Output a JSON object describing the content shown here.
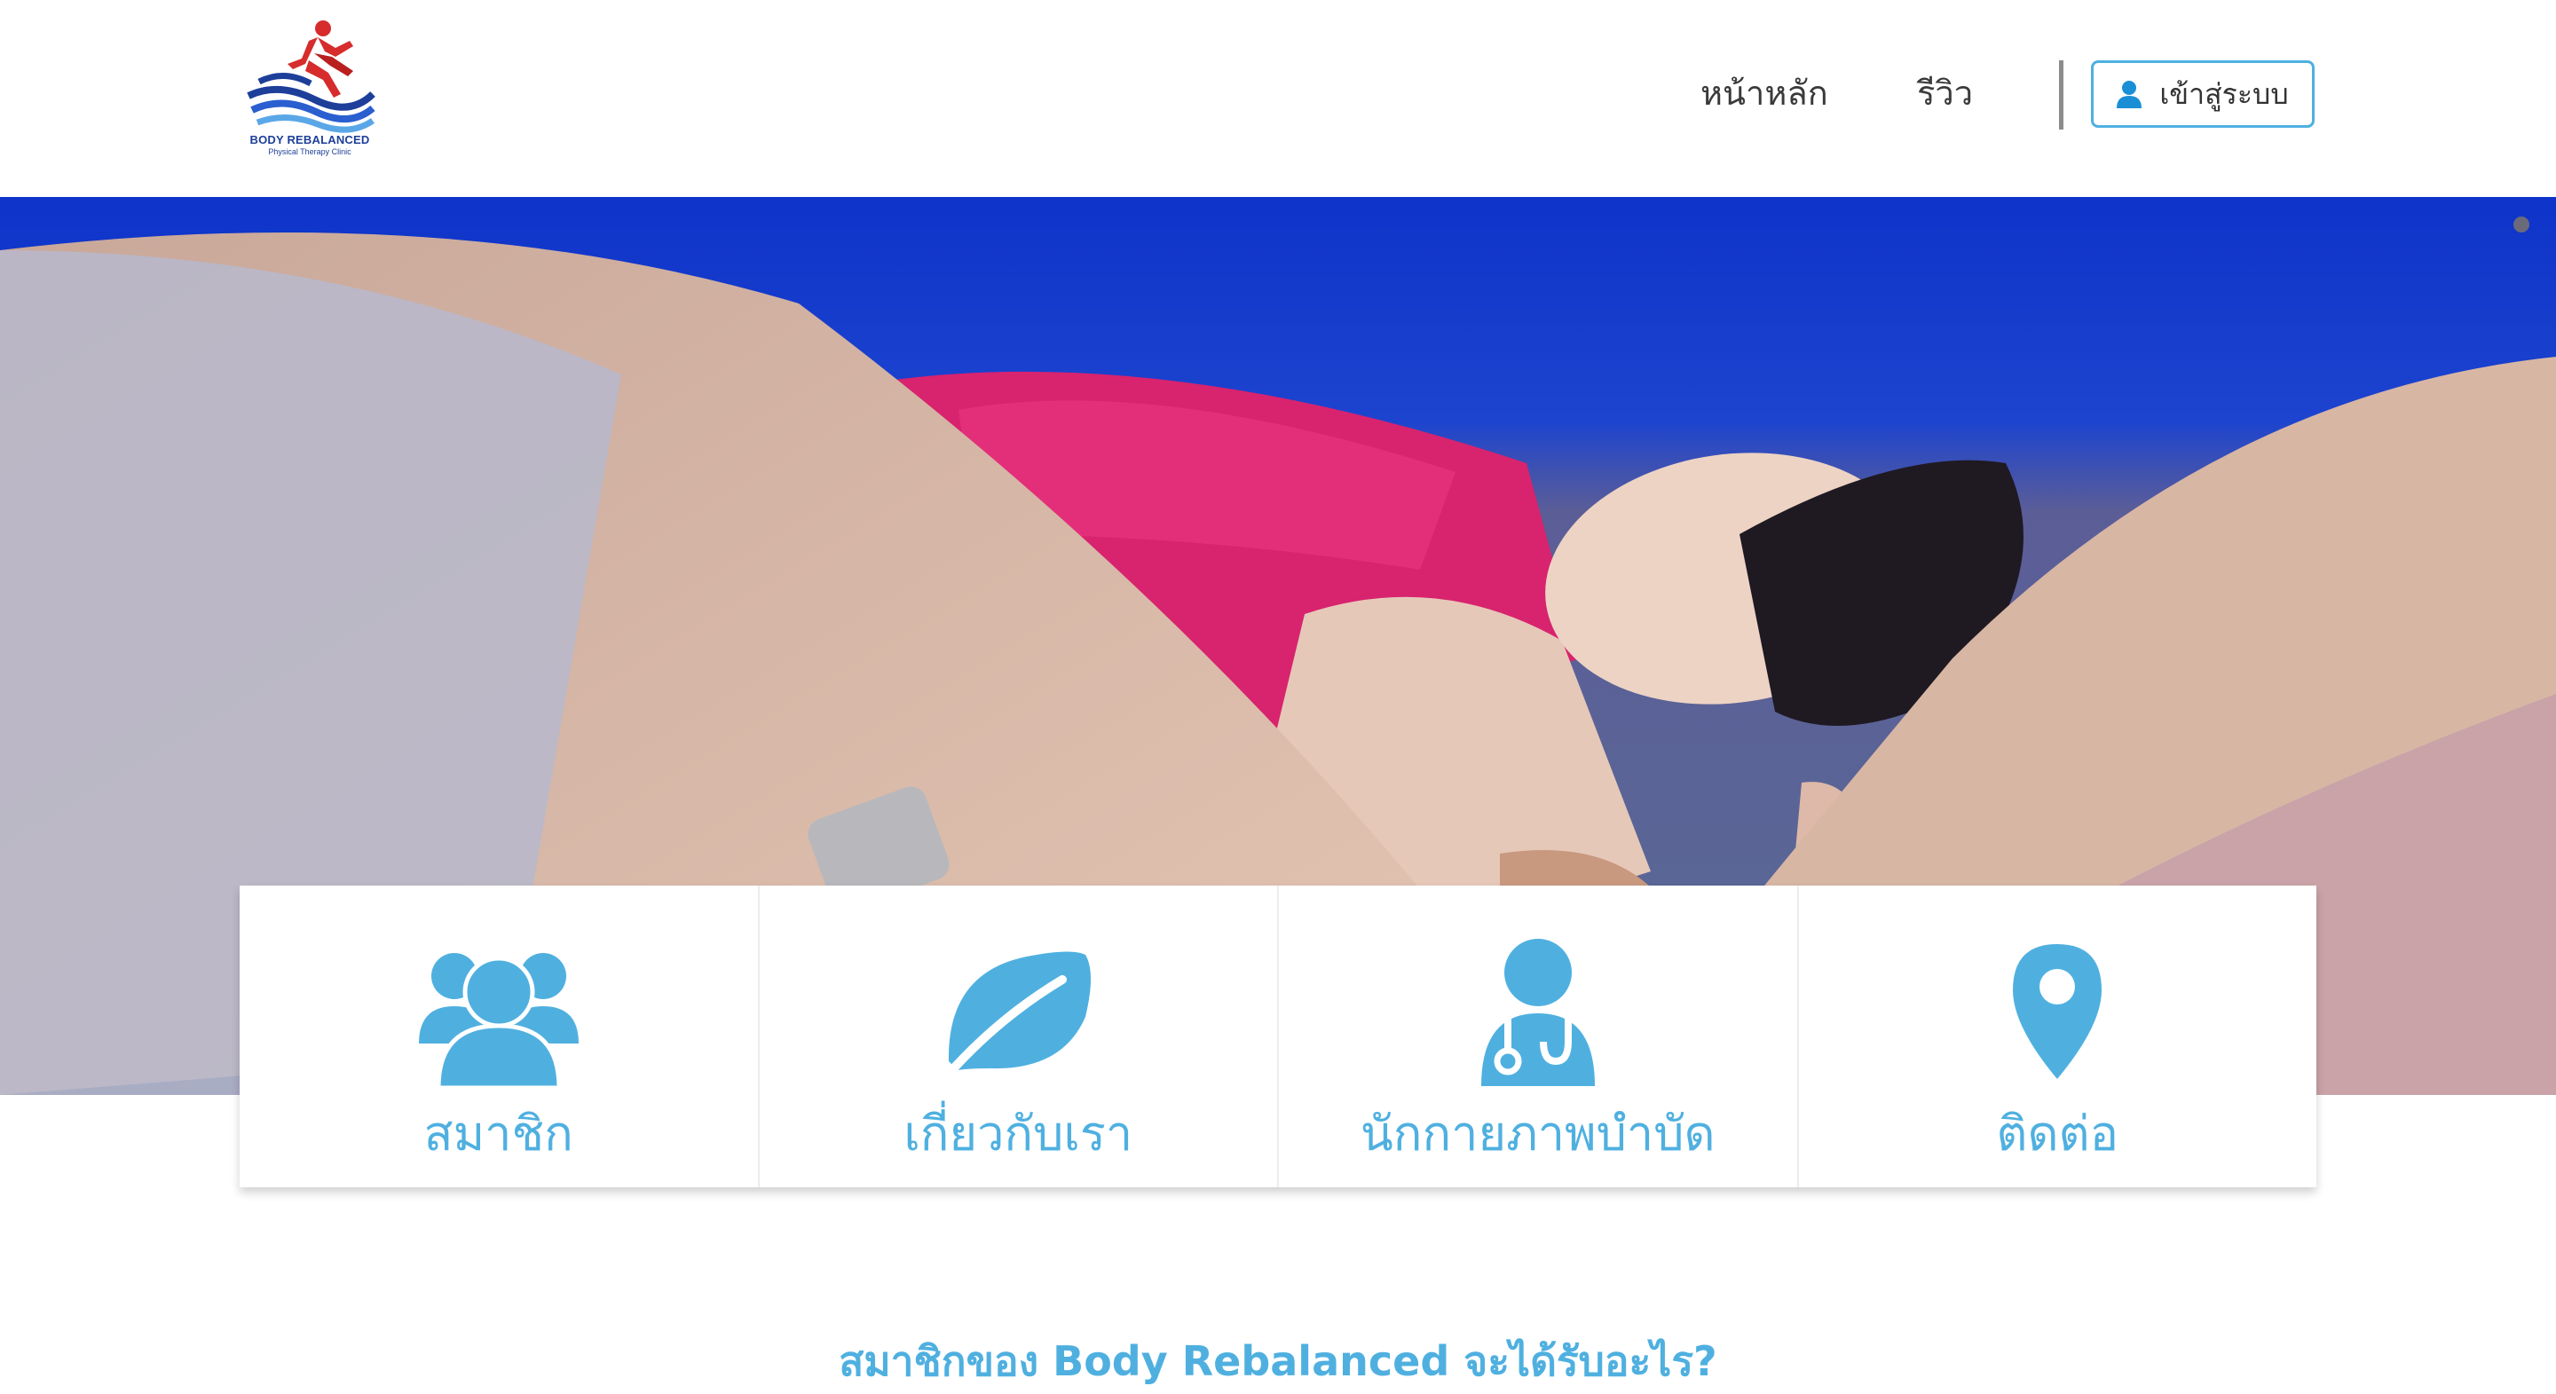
{
  "header": {
    "logo_text": "BODY REBALANCED",
    "logo_subtext": "Physical Therapy Clinic",
    "nav": {
      "home": "หน้าหลัก",
      "review": "รีวิว"
    },
    "login_label": "เข้าสู่ระบบ",
    "login_icon": "user-icon"
  },
  "features": [
    {
      "label": "สมาชิก",
      "icon": "users-icon"
    },
    {
      "label": "เกี่ยวกับเรา",
      "icon": "leaf-icon"
    },
    {
      "label": "นักกายภาพบำบัด",
      "icon": "doctor-icon"
    },
    {
      "label": "ติดต่อ",
      "icon": "map-marker-icon"
    }
  ],
  "section": {
    "title": "สมาชิกของ Body Rebalanced จะได้รับอะไร?"
  },
  "colors": {
    "accent": "#4fb0e0",
    "brand_blue": "#1d3f9a",
    "brand_red": "#d62c2c"
  }
}
